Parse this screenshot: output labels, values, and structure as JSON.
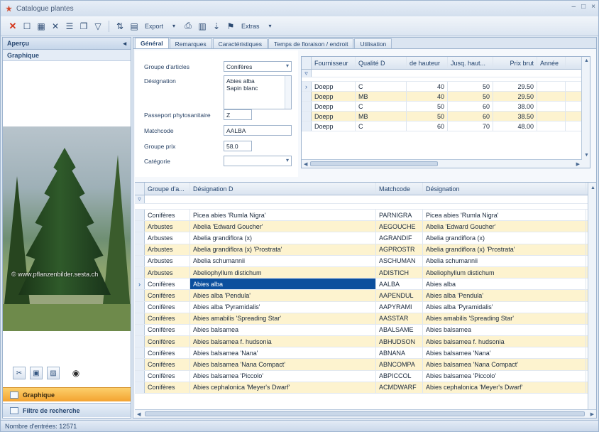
{
  "window": {
    "title": "Catalogue plantes",
    "controls": [
      "–",
      "□",
      "×"
    ]
  },
  "toolbar": {
    "export_label": "Export",
    "extras_label": "Extras"
  },
  "sidebar": {
    "header": "Aperçu",
    "subheader": "Graphique",
    "watermark": "© www.pflanzenbilder.sesta.ch",
    "nav_active": "Graphique",
    "nav_inactive": "Filtre de recherche"
  },
  "status": {
    "text": "Nombre d'entrées: 12571"
  },
  "tabs": [
    "Général",
    "Remarques",
    "Caractéristiques",
    "Temps de floraison / endroit",
    "Utilisation"
  ],
  "form": {
    "groupe_label": "Groupe d'articles",
    "groupe_value": "Conifères",
    "designation_label": "Désignation",
    "designation_line1": "Abies alba",
    "designation_line2": "Sapin blanc",
    "passeport_label": "Passeport phytosanitaire",
    "passeport_value": "Z",
    "matchcode_label": "Matchcode",
    "matchcode_value": "AALBA",
    "groupe_prix_label": "Groupe prix",
    "groupe_prix_value": "58.0",
    "categorie_label": "Catégorie",
    "categorie_value": ""
  },
  "supplier_grid": {
    "columns": [
      "Fournisseur",
      "Qualité D",
      "de hauteur",
      "Jusq. haut...",
      "Prix brut",
      "Année"
    ],
    "rows": [
      [
        "Doepp",
        "C",
        "40",
        "50",
        "29.50",
        ""
      ],
      [
        "Doepp",
        "MB",
        "40",
        "50",
        "29.50",
        ""
      ],
      [
        "Doepp",
        "C",
        "50",
        "60",
        "38.00",
        ""
      ],
      [
        "Doepp",
        "MB",
        "50",
        "60",
        "38.50",
        ""
      ],
      [
        "Doepp",
        "C",
        "60",
        "70",
        "48.00",
        ""
      ]
    ]
  },
  "article_grid": {
    "columns": [
      "Groupe d'a...",
      "Désignation D",
      "Matchcode",
      "Désignation"
    ],
    "rows": [
      [
        "Conifères",
        "Picea abies 'Rumla Nigra'",
        "PARNIGRA",
        "Picea abies 'Rumla Nigra'"
      ],
      [
        "Arbustes",
        "Abelia 'Edward Goucher'",
        "AEGOUCHE",
        "Abelia 'Edward Goucher'"
      ],
      [
        "Arbustes",
        "Abelia grandiflora (x)",
        "AGRANDIF",
        "Abelia grandiflora (x)"
      ],
      [
        "Arbustes",
        "Abelia grandiflora (x) 'Prostrata'",
        "AGPROSTR",
        "Abelia grandiflora (x) 'Prostrata'"
      ],
      [
        "Arbustes",
        "Abelia schumannii",
        "ASCHUMAN",
        "Abelia schumannii"
      ],
      [
        "Arbustes",
        "Abeliophyllum distichum",
        "ADISTICH",
        "Abeliophyllum distichum"
      ],
      [
        "Conifères",
        "Abies alba",
        "AALBA",
        "Abies alba"
      ],
      [
        "Conifères",
        "Abies alba 'Pendula'",
        "AAPENDUL",
        "Abies alba 'Pendula'"
      ],
      [
        "Conifères",
        "Abies alba 'Pyramidalis'",
        "AAPYRAMI",
        "Abies alba 'Pyramidalis'"
      ],
      [
        "Conifères",
        "Abies amabilis 'Spreading Star'",
        "AASSTAR",
        "Abies amabilis 'Spreading Star'"
      ],
      [
        "Conifères",
        "Abies balsamea",
        "ABALSAME",
        "Abies balsamea"
      ],
      [
        "Conifères",
        "Abies balsamea f. hudsonia",
        "ABHUDSON",
        "Abies balsamea f. hudsonia"
      ],
      [
        "Conifères",
        "Abies balsamea 'Nana'",
        "ABNANA",
        "Abies balsamea 'Nana'"
      ],
      [
        "Conifères",
        "Abies balsamea 'Nana Compact'",
        "ABNCOMPA",
        "Abies balsamea 'Nana Compact'"
      ],
      [
        "Conifères",
        "Abies balsamea 'Piccolo'",
        "ABPICCOL",
        "Abies balsamea 'Piccolo'"
      ],
      [
        "Conifères",
        "Abies cephalonica 'Meyer's Dwarf'",
        "ACMDWARF",
        "Abies cephalonica 'Meyer's Dwarf'"
      ]
    ]
  },
  "colors": {
    "selection": "#0b4f9e",
    "alt_row": "#fdf3cf",
    "nav_active": "#f3a330"
  }
}
